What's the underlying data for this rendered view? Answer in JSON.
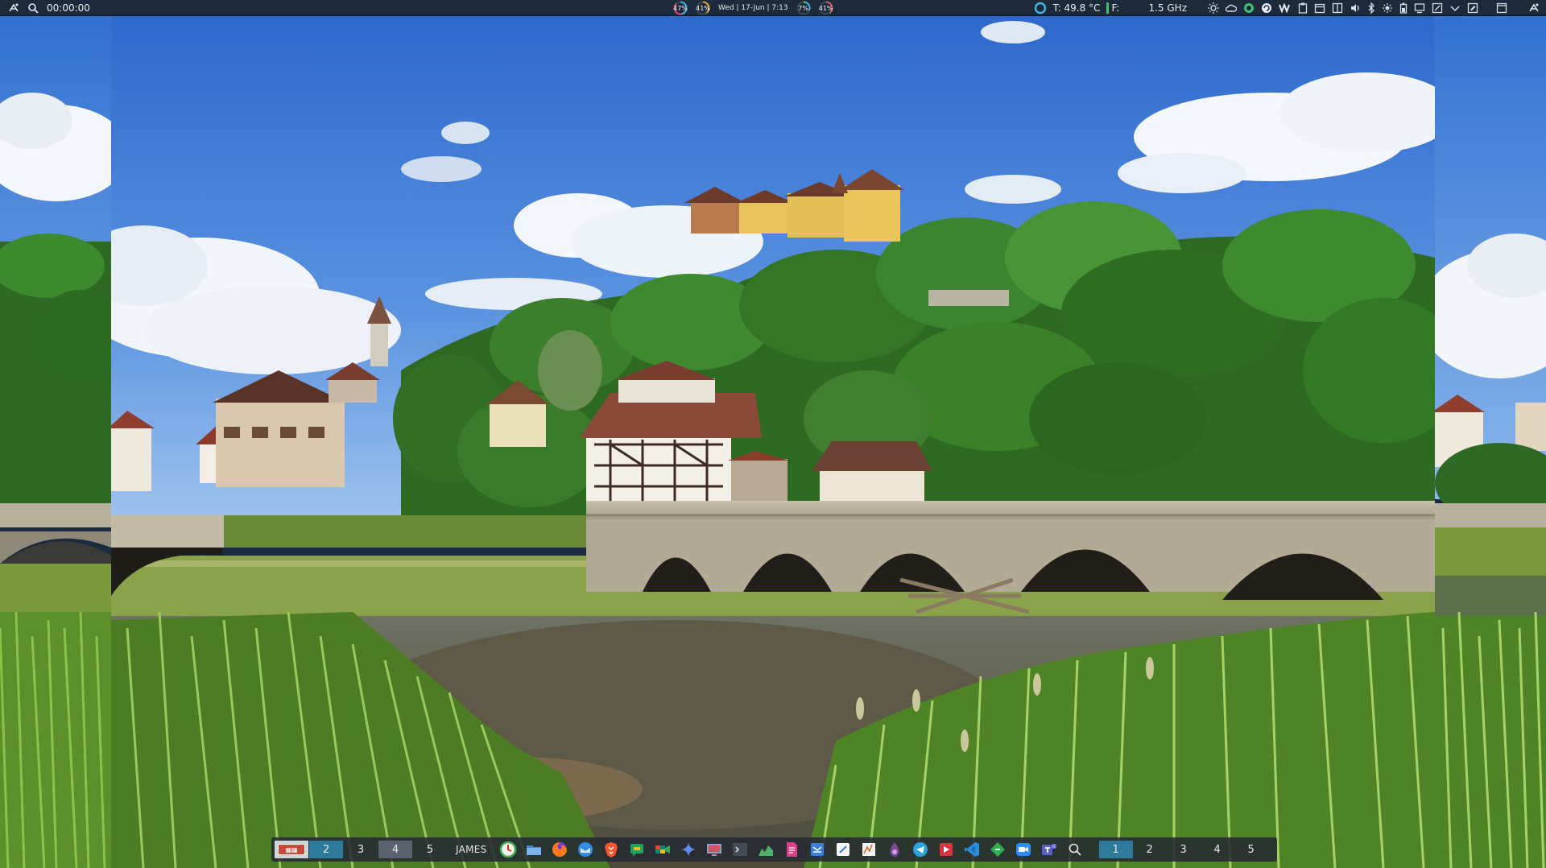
{
  "top_panel": {
    "timer": "00:00:00",
    "meters": [
      {
        "name": "cpu",
        "value": "47%",
        "color": "#3fb6e0"
      },
      {
        "name": "mem",
        "value": "41%",
        "color": "#e0a53f"
      },
      {
        "name": "disk",
        "value": "7%",
        "color": "#57d07a"
      },
      {
        "name": "swap",
        "value": "41%",
        "color": "#d85c5c"
      }
    ],
    "clock": "Wed  |  17-Jun  |  7:13",
    "temperature": "T: 49.8 °C",
    "fan_label": "F:",
    "cpu_freq": "1.5 GHz"
  },
  "dock": {
    "left_workspaces": [
      {
        "label": "",
        "state": "thumb"
      },
      {
        "label": "2",
        "state": "active"
      },
      {
        "label": "3",
        "state": "empty"
      },
      {
        "label": "4",
        "state": "occupied"
      },
      {
        "label": "5",
        "state": "empty"
      }
    ],
    "username": "JAMES",
    "apps": [
      {
        "name": "clock-app-icon",
        "color": "#3dae5b"
      },
      {
        "name": "file-manager-icon",
        "color": "#4a8ad6"
      },
      {
        "name": "firefox-icon",
        "color": "#ff7a1a"
      },
      {
        "name": "thunderbird-icon",
        "color": "#2f8de8"
      },
      {
        "name": "brave-icon",
        "color": "#fb542b"
      },
      {
        "name": "google-chat-icon",
        "color": "#1ea362"
      },
      {
        "name": "google-meet-icon",
        "color": "#00897b"
      },
      {
        "name": "gemini-icon",
        "color": "#5b8ef0"
      },
      {
        "name": "remote-desktop-icon",
        "color": "#8aa1bb"
      },
      {
        "name": "terminal-icon",
        "color": "#444b55"
      },
      {
        "name": "system-monitor-icon",
        "color": "#4fb06a"
      },
      {
        "name": "pdf-reader-icon",
        "color": "#e0408a"
      },
      {
        "name": "mail-client-icon",
        "color": "#3a7ee0"
      },
      {
        "name": "text-editor-icon",
        "color": "#f5f6f7"
      },
      {
        "name": "document-viewer-icon",
        "color": "#f2f2f2"
      },
      {
        "name": "tor-browser-icon",
        "color": "#7d4698"
      },
      {
        "name": "telegram-icon",
        "color": "#2aa3de"
      },
      {
        "name": "media-player-icon",
        "color": "#d8343c"
      },
      {
        "name": "vscode-icon",
        "color": "#2b8fd9"
      },
      {
        "name": "git-client-icon",
        "color": "#2fae4f"
      },
      {
        "name": "zoom-icon",
        "color": "#2d8cff"
      },
      {
        "name": "teams-icon",
        "color": "#5b5fc7"
      },
      {
        "name": "search-icon",
        "color": "#e4e8ec"
      }
    ],
    "right_workspaces": [
      {
        "label": "1",
        "state": "active"
      },
      {
        "label": "2",
        "state": "empty"
      },
      {
        "label": "3",
        "state": "empty"
      },
      {
        "label": "4",
        "state": "empty"
      },
      {
        "label": "5",
        "state": "empty"
      }
    ]
  }
}
